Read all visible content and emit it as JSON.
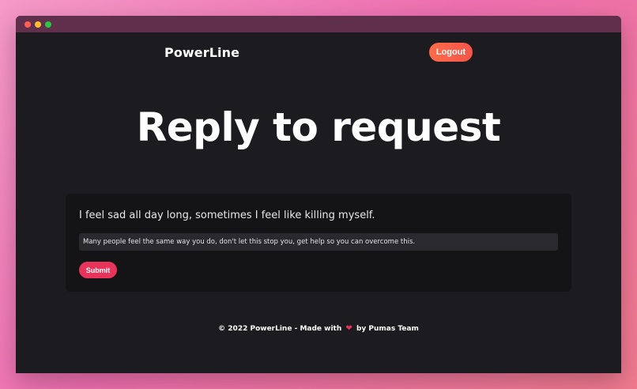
{
  "header": {
    "brand": "PowerLine",
    "logout_label": "Logout"
  },
  "main": {
    "title": "Reply to request",
    "request_text": "I feel sad all day long, sometimes I feel like killing myself.",
    "reply_value": "Many people feel the same way you do, don't let this stop you, get help so you can overcome this.",
    "submit_label": "Submit"
  },
  "footer": {
    "text_before": "© 2022 PowerLine - Made with",
    "heart": "❤",
    "text_after": "by Pumas Team"
  },
  "colors": {
    "background": "#1c1b1f",
    "card": "#141316",
    "accent": "#e8335a",
    "logout": "#f2564a"
  }
}
